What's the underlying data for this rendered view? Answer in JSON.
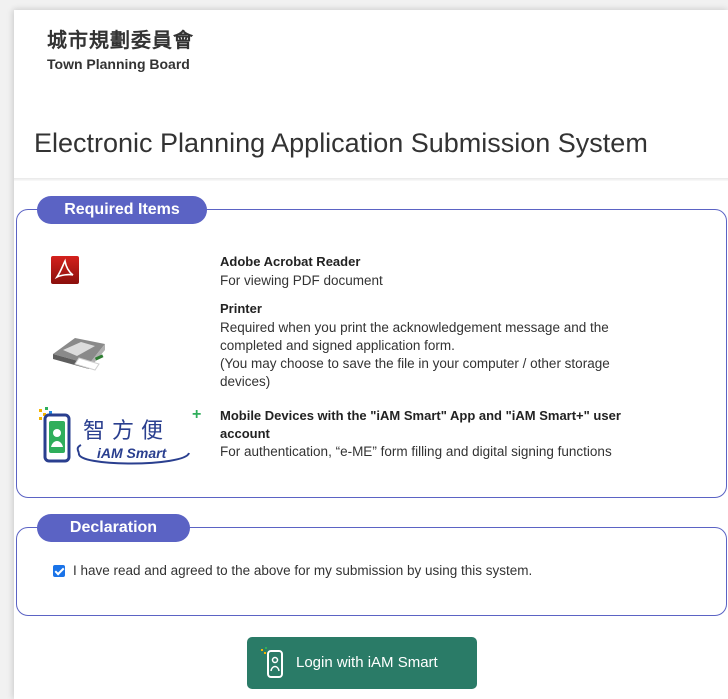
{
  "header": {
    "name_zh": "城市規劃委員會",
    "name_en": "Town Planning Board"
  },
  "page_title": "Electronic Planning Application Submission System",
  "required_items": {
    "heading": "Required Items",
    "items": [
      {
        "icon": "adobe-acrobat-icon",
        "title": "Adobe Acrobat Reader",
        "description": [
          "For viewing PDF document"
        ]
      },
      {
        "icon": "printer-icon",
        "title": "Printer",
        "description": [
          "Required when you print the acknowledgement message and the",
          "completed and signed application form.",
          "(You may choose to save the file in your computer / other storage",
          "devices)"
        ]
      },
      {
        "icon": "iam-smart-icon",
        "logo_text_zh": "智方便",
        "logo_text_en": "iAM Smart",
        "title": [
          "Mobile Devices with the \"iAM Smart\" App and \"iAM Smart+\" user",
          "account"
        ],
        "description": [
          "For authentication, “e-ME” form filling and digital signing functions"
        ]
      }
    ]
  },
  "declaration": {
    "heading": "Declaration",
    "checked": true,
    "text": "I have read and agreed to the above for my submission by using this system."
  },
  "login_button": {
    "label": "Login with iAM Smart"
  },
  "colors": {
    "panel_accent": "#5b63c4",
    "login_button": "#2a7b67",
    "checkbox": "#1a73e8"
  }
}
